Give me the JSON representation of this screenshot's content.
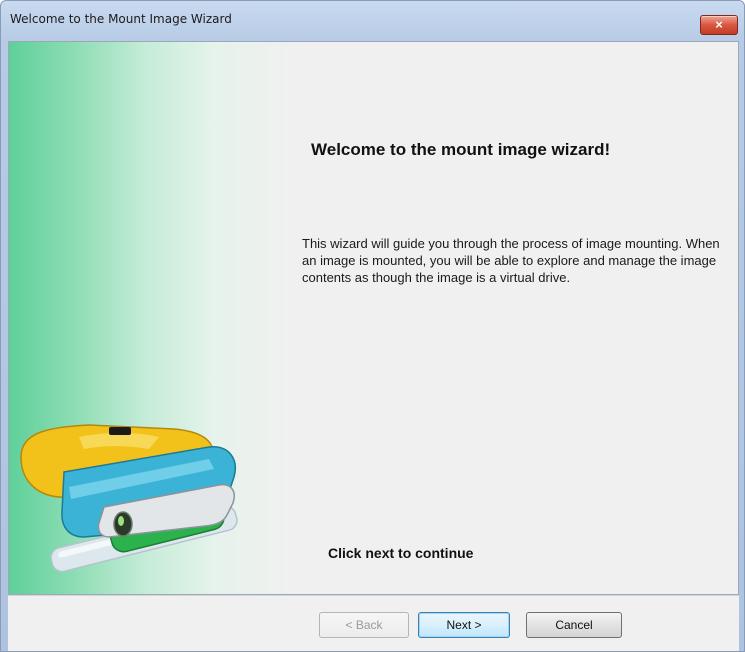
{
  "window": {
    "title": "Welcome to the Mount Image Wizard",
    "close_glyph": "×"
  },
  "content": {
    "heading": "Welcome to the mount image wizard!",
    "description": "This wizard will guide you through the process of image mounting. When an image is mounted, you will be able to explore and manage the image contents as though the image is a virtual drive.",
    "cta": "Click next to continue",
    "illustration": "usb-drive-icon"
  },
  "buttons": {
    "back": "< Back",
    "next": "Next >",
    "cancel": "Cancel"
  },
  "colors": {
    "accent": "#3c7fb1",
    "close": "#d9573f",
    "panel_green": "#5fd09a",
    "drive_yellow": "#f2c21a",
    "drive_blue": "#3ab3d6",
    "plug_green": "#2bb24c"
  }
}
